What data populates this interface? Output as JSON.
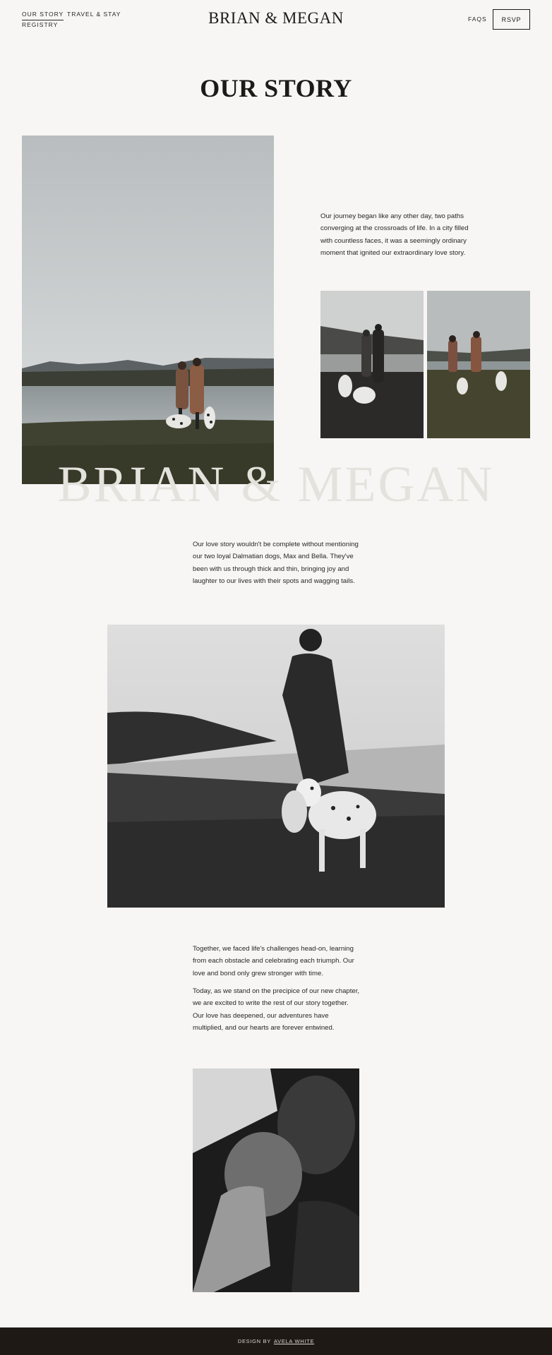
{
  "header": {
    "nav_left": [
      "OUR STORY",
      "TRAVEL & STAY",
      "REGISTRY"
    ],
    "site_title": "BRIAN & MEGAN",
    "faqs_label": "FAQS",
    "rsvp_label": "RSVP"
  },
  "main": {
    "heading": "OUR STORY",
    "intro_text": "Our journey began like any other day, two paths converging at the crossroads of life. In a city filled with countless faces, it was a seemingly ordinary moment that ignited our extraordinary love story.",
    "watermark": "BRIAN & MEGAN",
    "dogs_text": "Our love story wouldn't be complete without mentioning our two loyal Dalmatian dogs, Max and Bella. They've been with us through thick and thin, bringing joy and laughter to our lives with their spots and wagging tails.",
    "together_text": "Together, we faced life's challenges head-on, learning from each obstacle and celebrating each triumph. Our love and bond only grew stronger with time.",
    "today_text": "Today, as we stand on the precipice of our new chapter, we are excited to write the rest of our story together. Our love has deepened, our adventures have multiplied, and our hearts are forever entwined."
  },
  "footer": {
    "design_by": "DESIGN BY",
    "designer_link": "AVELA WHITE"
  },
  "colors": {
    "background": "#f7f6f4",
    "text": "#1d1a17",
    "watermark": "#e4e2dc",
    "footer_bg": "#1e1914"
  }
}
